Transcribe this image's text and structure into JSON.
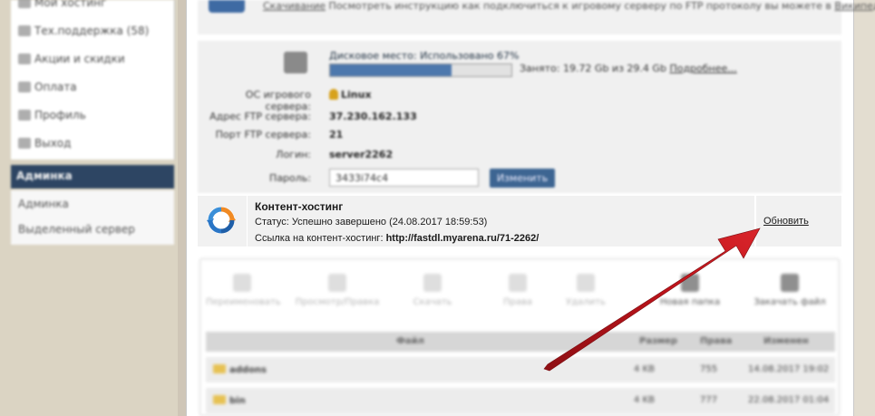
{
  "content_hosting": {
    "title": "Контент-хостинг",
    "status": "Статус: Успешно завершено (24.08.2017 18:59:53)",
    "link_label": "Ссылка на контент-хостинг:",
    "link_url": "http://fastdl.myarena.ru/71-2262/",
    "refresh_label": "Обновить"
  },
  "sidebar": {
    "items": [
      {
        "label": "Мой хостинг"
      },
      {
        "label": "Тех.поддержка (58)"
      },
      {
        "label": "Акции и скидки"
      },
      {
        "label": "Оплата"
      },
      {
        "label": "Профиль"
      },
      {
        "label": "Выход"
      }
    ],
    "section_title": "Админка",
    "sub_items": [
      {
        "label": "Админка"
      },
      {
        "label": "Выделенный сервер"
      }
    ]
  },
  "info": {
    "top_link": "Скачивание",
    "top_text": "Посмотреть инструкцию как подключиться к игровому серверу по FTP протоколу вы можете в",
    "top_link2": "Википедии",
    "disk_label": "Дисковое место: Использовано 67%",
    "disk_used_fraction": 0.67,
    "used_text": "Занято: 19.72 Gb из 29.4 Gb",
    "used_more": "Подробнее...",
    "rows": [
      {
        "label": "ОС игрового сервера:",
        "value": "Linux"
      },
      {
        "label": "Адрес FTP сервера:",
        "value": "37.230.162.133"
      },
      {
        "label": "Порт FTP сервера:",
        "value": "21"
      },
      {
        "label": "Логин:",
        "value": "server2262"
      }
    ],
    "password_label": "Пароль:",
    "password_value": "3433i74c4",
    "change_button": "Изменить"
  },
  "file_manager": {
    "tools": [
      "Переименовать",
      "Просмотр/Правка",
      "Скачать",
      "Права",
      "Удалить",
      "Новая папка",
      "Закачать файл"
    ],
    "columns": [
      "Файл",
      "Размер",
      "Права",
      "Изменен"
    ],
    "rows": [
      {
        "name": "addons",
        "size": "4 KB",
        "perms": "755",
        "modified": "14.08.2017 19:02"
      },
      {
        "name": "bin",
        "size": "4 KB",
        "perms": "777",
        "modified": "22.08.2017 01:04"
      }
    ]
  },
  "colors": {
    "arrow": "#c0141b",
    "section_bg": "#2d4563",
    "progress_fill": "#4d78ad"
  }
}
